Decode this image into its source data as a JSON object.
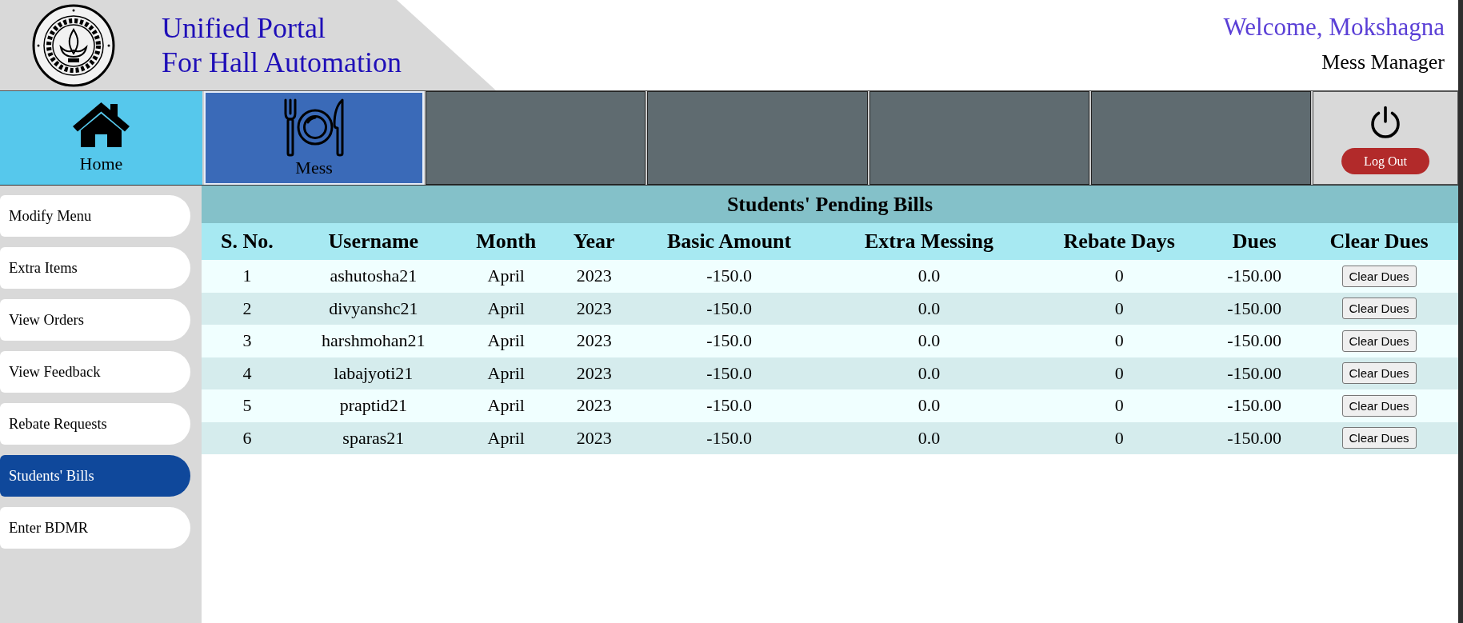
{
  "header": {
    "title_lines": [
      "Unified Portal",
      "For Hall Automation"
    ],
    "welcome": "Welcome, Mokshagna",
    "role": "Mess Manager"
  },
  "nav": {
    "tiles": [
      {
        "kind": "home",
        "label": "Home",
        "selected": false
      },
      {
        "kind": "mess",
        "label": "Mess",
        "selected": true
      },
      {
        "kind": "blank",
        "selected": false
      },
      {
        "kind": "blank",
        "selected": false
      },
      {
        "kind": "blank",
        "selected": false
      },
      {
        "kind": "blank",
        "selected": false
      },
      {
        "kind": "logout",
        "button": "Log Out",
        "selected": false
      }
    ]
  },
  "sidebar": {
    "items": [
      {
        "label": "Modify Menu",
        "selected": false
      },
      {
        "label": "Extra Items",
        "selected": false
      },
      {
        "label": "View Orders",
        "selected": false
      },
      {
        "label": "View Feedback",
        "selected": false
      },
      {
        "label": "Rebate Requests",
        "selected": false
      },
      {
        "label": "Students' Bills",
        "selected": true
      },
      {
        "label": "Enter BDMR",
        "selected": false
      }
    ]
  },
  "table": {
    "title": "Students' Pending Bills",
    "columns": [
      "S. No.",
      "Username",
      "Month",
      "Year",
      "Basic Amount",
      "Extra Messing",
      "Rebate Days",
      "Dues",
      "Clear Dues"
    ],
    "rows": [
      {
        "cells": [
          "1",
          "ashutosha21",
          "April",
          "2023",
          "-150.0",
          "0.0",
          "0",
          "-150.00"
        ],
        "action": "Clear Dues"
      },
      {
        "cells": [
          "2",
          "divyanshc21",
          "April",
          "2023",
          "-150.0",
          "0.0",
          "0",
          "-150.00"
        ],
        "action": "Clear Dues"
      },
      {
        "cells": [
          "3",
          "harshmohan21",
          "April",
          "2023",
          "-150.0",
          "0.0",
          "0",
          "-150.00"
        ],
        "action": "Clear Dues"
      },
      {
        "cells": [
          "4",
          "labajyoti21",
          "April",
          "2023",
          "-150.0",
          "0.0",
          "0",
          "-150.00"
        ],
        "action": "Clear Dues"
      },
      {
        "cells": [
          "5",
          "praptid21",
          "April",
          "2023",
          "-150.0",
          "0.0",
          "0",
          "-150.00"
        ],
        "action": "Clear Dues"
      },
      {
        "cells": [
          "6",
          "sparas21",
          "April",
          "2023",
          "-150.0",
          "0.0",
          "0",
          "-150.00"
        ],
        "action": "Clear Dues"
      }
    ]
  }
}
